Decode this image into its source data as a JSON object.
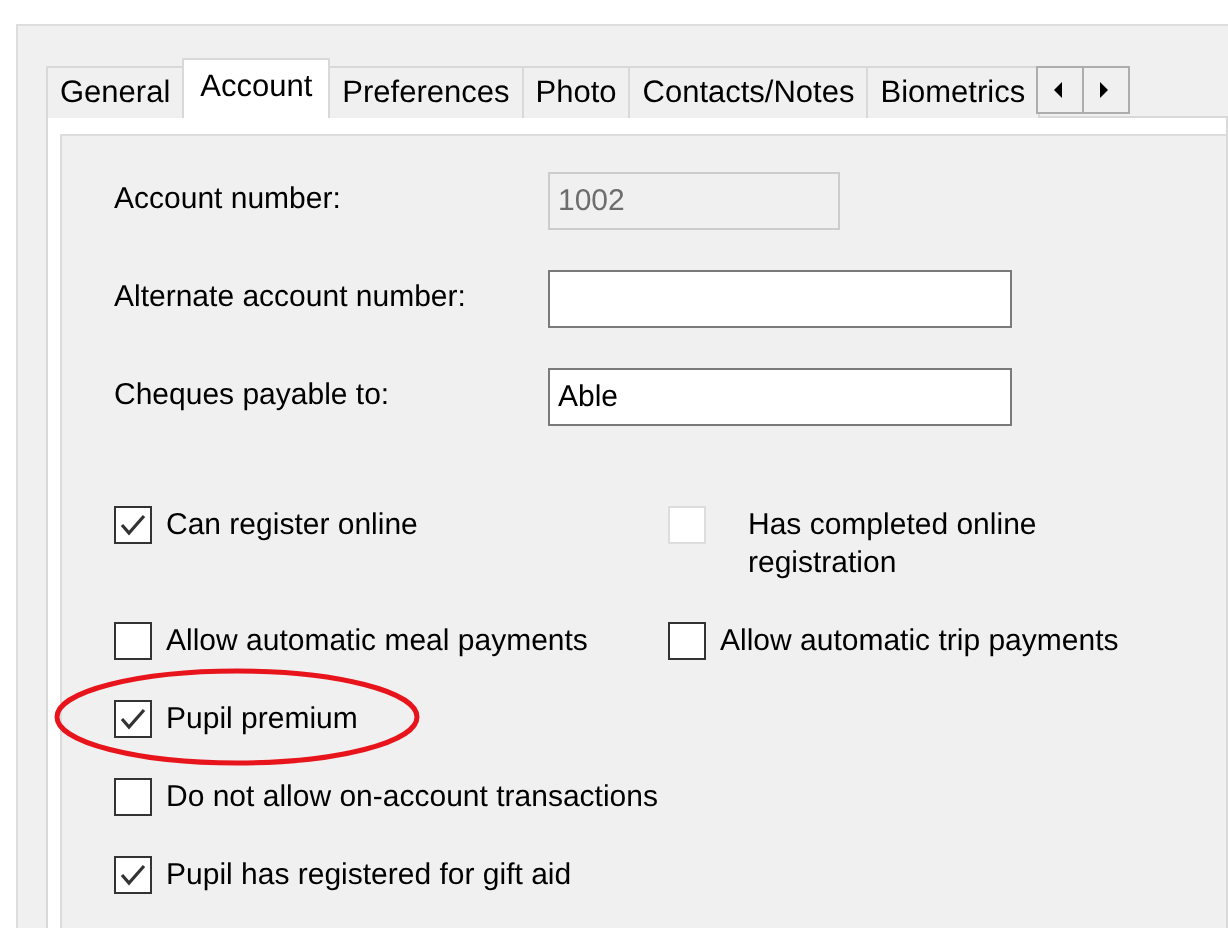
{
  "tabs": [
    {
      "label": "General",
      "selected": false
    },
    {
      "label": "Account",
      "selected": true
    },
    {
      "label": "Preferences",
      "selected": false
    },
    {
      "label": "Photo",
      "selected": false
    },
    {
      "label": "Contacts/Notes",
      "selected": false
    },
    {
      "label": "Biometrics",
      "selected": false
    }
  ],
  "fields": [
    {
      "label": "Account number:",
      "value": "1002",
      "disabled": true,
      "wide": false
    },
    {
      "label": "Alternate account number:",
      "disabled": false,
      "wide": true
    },
    {
      "label": "Cheques payable to:",
      "value": "Able",
      "disabled": false,
      "wide": true
    }
  ],
  "checkbox_rows": [
    [
      {
        "label": "Can register online",
        "checked": true,
        "disabled": false,
        "circled": false
      },
      {
        "label": "Has completed online registration",
        "checked": false,
        "disabled": true,
        "circled": false
      }
    ],
    [
      {
        "label": "Allow automatic meal payments",
        "checked": false,
        "disabled": false,
        "circled": false
      },
      {
        "label": "Allow automatic trip payments",
        "checked": false,
        "disabled": false,
        "circled": false
      }
    ],
    [
      {
        "label": "Pupil premium",
        "checked": true,
        "disabled": false,
        "circled": true
      }
    ],
    [
      {
        "label": "Do not allow on-account transactions",
        "checked": false,
        "disabled": false,
        "circled": false
      }
    ],
    [
      {
        "label": "Pupil has registered for gift aid",
        "checked": true,
        "disabled": false,
        "circled": false
      }
    ]
  ]
}
